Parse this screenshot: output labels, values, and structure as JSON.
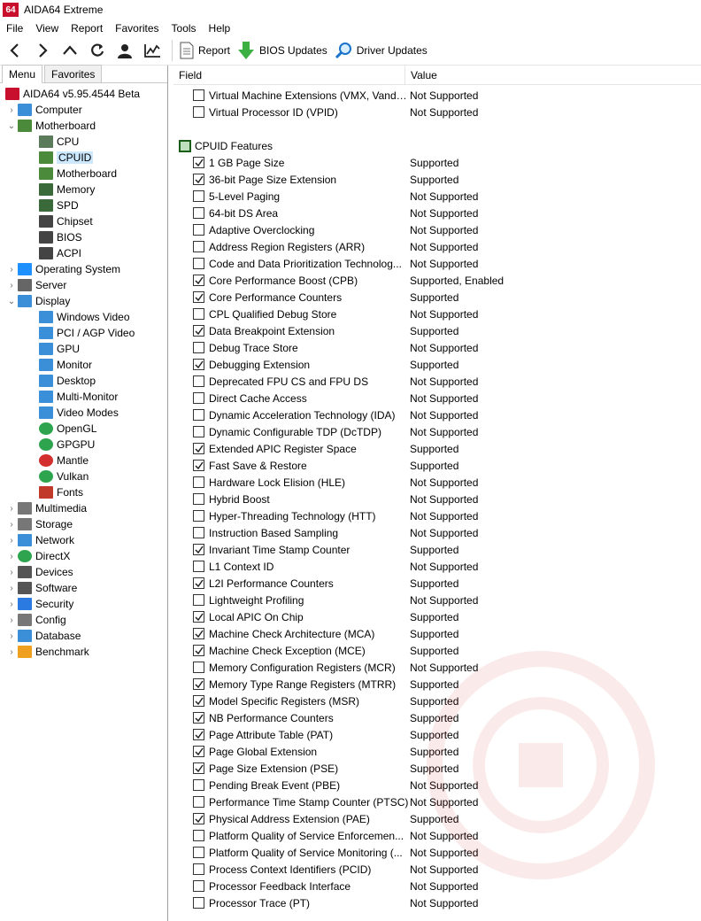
{
  "window": {
    "title": "AIDA64 Extreme",
    "logo_text": "64"
  },
  "menu": [
    "File",
    "View",
    "Report",
    "Favorites",
    "Tools",
    "Help"
  ],
  "toolbar": {
    "report_label": "Report",
    "bios_label": "BIOS Updates",
    "driver_label": "Driver Updates"
  },
  "tabs": [
    "Menu",
    "Favorites"
  ],
  "tree": [
    {
      "label": "AIDA64 v5.95.4544 Beta",
      "indent": 0,
      "exp": "",
      "icon": "aida-icon"
    },
    {
      "label": "Computer",
      "indent": 1,
      "exp": "›",
      "icon": "computer-icon"
    },
    {
      "label": "Motherboard",
      "indent": 1,
      "exp": "⌄",
      "icon": "motherboard-icon"
    },
    {
      "label": "CPU",
      "indent": 2,
      "exp": "",
      "icon": "cpu-icon"
    },
    {
      "label": "CPUID",
      "indent": 2,
      "exp": "",
      "icon": "cpuid-icon",
      "selected": true
    },
    {
      "label": "Motherboard",
      "indent": 2,
      "exp": "",
      "icon": "motherboard-icon"
    },
    {
      "label": "Memory",
      "indent": 2,
      "exp": "",
      "icon": "memory-icon"
    },
    {
      "label": "SPD",
      "indent": 2,
      "exp": "",
      "icon": "spd-icon"
    },
    {
      "label": "Chipset",
      "indent": 2,
      "exp": "",
      "icon": "chipset-icon"
    },
    {
      "label": "BIOS",
      "indent": 2,
      "exp": "",
      "icon": "bios-icon"
    },
    {
      "label": "ACPI",
      "indent": 2,
      "exp": "",
      "icon": "acpi-icon"
    },
    {
      "label": "Operating System",
      "indent": 1,
      "exp": "›",
      "icon": "windows-icon"
    },
    {
      "label": "Server",
      "indent": 1,
      "exp": "›",
      "icon": "server-icon"
    },
    {
      "label": "Display",
      "indent": 1,
      "exp": "⌄",
      "icon": "display-icon"
    },
    {
      "label": "Windows Video",
      "indent": 2,
      "exp": "",
      "icon": "windows-video-icon"
    },
    {
      "label": "PCI / AGP Video",
      "indent": 2,
      "exp": "",
      "icon": "pci-video-icon"
    },
    {
      "label": "GPU",
      "indent": 2,
      "exp": "",
      "icon": "gpu-icon"
    },
    {
      "label": "Monitor",
      "indent": 2,
      "exp": "",
      "icon": "monitor-icon"
    },
    {
      "label": "Desktop",
      "indent": 2,
      "exp": "",
      "icon": "desktop-icon"
    },
    {
      "label": "Multi-Monitor",
      "indent": 2,
      "exp": "",
      "icon": "multi-monitor-icon"
    },
    {
      "label": "Video Modes",
      "indent": 2,
      "exp": "",
      "icon": "video-modes-icon"
    },
    {
      "label": "OpenGL",
      "indent": 2,
      "exp": "",
      "icon": "opengl-icon"
    },
    {
      "label": "GPGPU",
      "indent": 2,
      "exp": "",
      "icon": "gpgpu-icon"
    },
    {
      "label": "Mantle",
      "indent": 2,
      "exp": "",
      "icon": "mantle-icon"
    },
    {
      "label": "Vulkan",
      "indent": 2,
      "exp": "",
      "icon": "vulkan-icon"
    },
    {
      "label": "Fonts",
      "indent": 2,
      "exp": "",
      "icon": "fonts-icon"
    },
    {
      "label": "Multimedia",
      "indent": 1,
      "exp": "›",
      "icon": "multimedia-icon"
    },
    {
      "label": "Storage",
      "indent": 1,
      "exp": "›",
      "icon": "storage-icon"
    },
    {
      "label": "Network",
      "indent": 1,
      "exp": "›",
      "icon": "network-icon"
    },
    {
      "label": "DirectX",
      "indent": 1,
      "exp": "›",
      "icon": "directx-icon"
    },
    {
      "label": "Devices",
      "indent": 1,
      "exp": "›",
      "icon": "devices-icon"
    },
    {
      "label": "Software",
      "indent": 1,
      "exp": "›",
      "icon": "software-icon"
    },
    {
      "label": "Security",
      "indent": 1,
      "exp": "›",
      "icon": "security-icon"
    },
    {
      "label": "Config",
      "indent": 1,
      "exp": "›",
      "icon": "config-icon"
    },
    {
      "label": "Database",
      "indent": 1,
      "exp": "›",
      "icon": "database-icon"
    },
    {
      "label": "Benchmark",
      "indent": 1,
      "exp": "›",
      "icon": "benchmark-icon"
    }
  ],
  "columns": {
    "field": "Field",
    "value": "Value"
  },
  "top_rows": [
    {
      "field": "Virtual Machine Extensions (VMX, Vande...",
      "value": "Not Supported",
      "checked": false
    },
    {
      "field": "Virtual Processor ID (VPID)",
      "value": "Not Supported",
      "checked": false
    }
  ],
  "group_title": "CPUID Features",
  "rows": [
    {
      "field": "1 GB Page Size",
      "value": "Supported",
      "checked": true
    },
    {
      "field": "36-bit Page Size Extension",
      "value": "Supported",
      "checked": true
    },
    {
      "field": "5-Level Paging",
      "value": "Not Supported",
      "checked": false
    },
    {
      "field": "64-bit DS Area",
      "value": "Not Supported",
      "checked": false
    },
    {
      "field": "Adaptive Overclocking",
      "value": "Not Supported",
      "checked": false
    },
    {
      "field": "Address Region Registers (ARR)",
      "value": "Not Supported",
      "checked": false
    },
    {
      "field": "Code and Data Prioritization Technolog...",
      "value": "Not Supported",
      "checked": false
    },
    {
      "field": "Core Performance Boost (CPB)",
      "value": "Supported, Enabled",
      "checked": true
    },
    {
      "field": "Core Performance Counters",
      "value": "Supported",
      "checked": true
    },
    {
      "field": "CPL Qualified Debug Store",
      "value": "Not Supported",
      "checked": false
    },
    {
      "field": "Data Breakpoint Extension",
      "value": "Supported",
      "checked": true
    },
    {
      "field": "Debug Trace Store",
      "value": "Not Supported",
      "checked": false
    },
    {
      "field": "Debugging Extension",
      "value": "Supported",
      "checked": true
    },
    {
      "field": "Deprecated FPU CS and FPU DS",
      "value": "Not Supported",
      "checked": false
    },
    {
      "field": "Direct Cache Access",
      "value": "Not Supported",
      "checked": false
    },
    {
      "field": "Dynamic Acceleration Technology (IDA)",
      "value": "Not Supported",
      "checked": false
    },
    {
      "field": "Dynamic Configurable TDP (DcTDP)",
      "value": "Not Supported",
      "checked": false
    },
    {
      "field": "Extended APIC Register Space",
      "value": "Supported",
      "checked": true
    },
    {
      "field": "Fast Save & Restore",
      "value": "Supported",
      "checked": true
    },
    {
      "field": "Hardware Lock Elision (HLE)",
      "value": "Not Supported",
      "checked": false
    },
    {
      "field": "Hybrid Boost",
      "value": "Not Supported",
      "checked": false
    },
    {
      "field": "Hyper-Threading Technology (HTT)",
      "value": "Not Supported",
      "checked": false
    },
    {
      "field": "Instruction Based Sampling",
      "value": "Not Supported",
      "checked": false
    },
    {
      "field": "Invariant Time Stamp Counter",
      "value": "Supported",
      "checked": true
    },
    {
      "field": "L1 Context ID",
      "value": "Not Supported",
      "checked": false
    },
    {
      "field": "L2I Performance Counters",
      "value": "Supported",
      "checked": true
    },
    {
      "field": "Lightweight Profiling",
      "value": "Not Supported",
      "checked": false
    },
    {
      "field": "Local APIC On Chip",
      "value": "Supported",
      "checked": true
    },
    {
      "field": "Machine Check Architecture (MCA)",
      "value": "Supported",
      "checked": true
    },
    {
      "field": "Machine Check Exception (MCE)",
      "value": "Supported",
      "checked": true
    },
    {
      "field": "Memory Configuration Registers (MCR)",
      "value": "Not Supported",
      "checked": false
    },
    {
      "field": "Memory Type Range Registers (MTRR)",
      "value": "Supported",
      "checked": true
    },
    {
      "field": "Model Specific Registers (MSR)",
      "value": "Supported",
      "checked": true
    },
    {
      "field": "NB Performance Counters",
      "value": "Supported",
      "checked": true
    },
    {
      "field": "Page Attribute Table (PAT)",
      "value": "Supported",
      "checked": true
    },
    {
      "field": "Page Global Extension",
      "value": "Supported",
      "checked": true
    },
    {
      "field": "Page Size Extension (PSE)",
      "value": "Supported",
      "checked": true
    },
    {
      "field": "Pending Break Event (PBE)",
      "value": "Not Supported",
      "checked": false
    },
    {
      "field": "Performance Time Stamp Counter (PTSC)",
      "value": "Not Supported",
      "checked": false
    },
    {
      "field": "Physical Address Extension (PAE)",
      "value": "Supported",
      "checked": true
    },
    {
      "field": "Platform Quality of Service Enforcemen...",
      "value": "Not Supported",
      "checked": false
    },
    {
      "field": "Platform Quality of Service Monitoring (...",
      "value": "Not Supported",
      "checked": false
    },
    {
      "field": "Process Context Identifiers (PCID)",
      "value": "Not Supported",
      "checked": false
    },
    {
      "field": "Processor Feedback Interface",
      "value": "Not Supported",
      "checked": false
    },
    {
      "field": "Processor Trace (PT)",
      "value": "Not Supported",
      "checked": false
    }
  ]
}
